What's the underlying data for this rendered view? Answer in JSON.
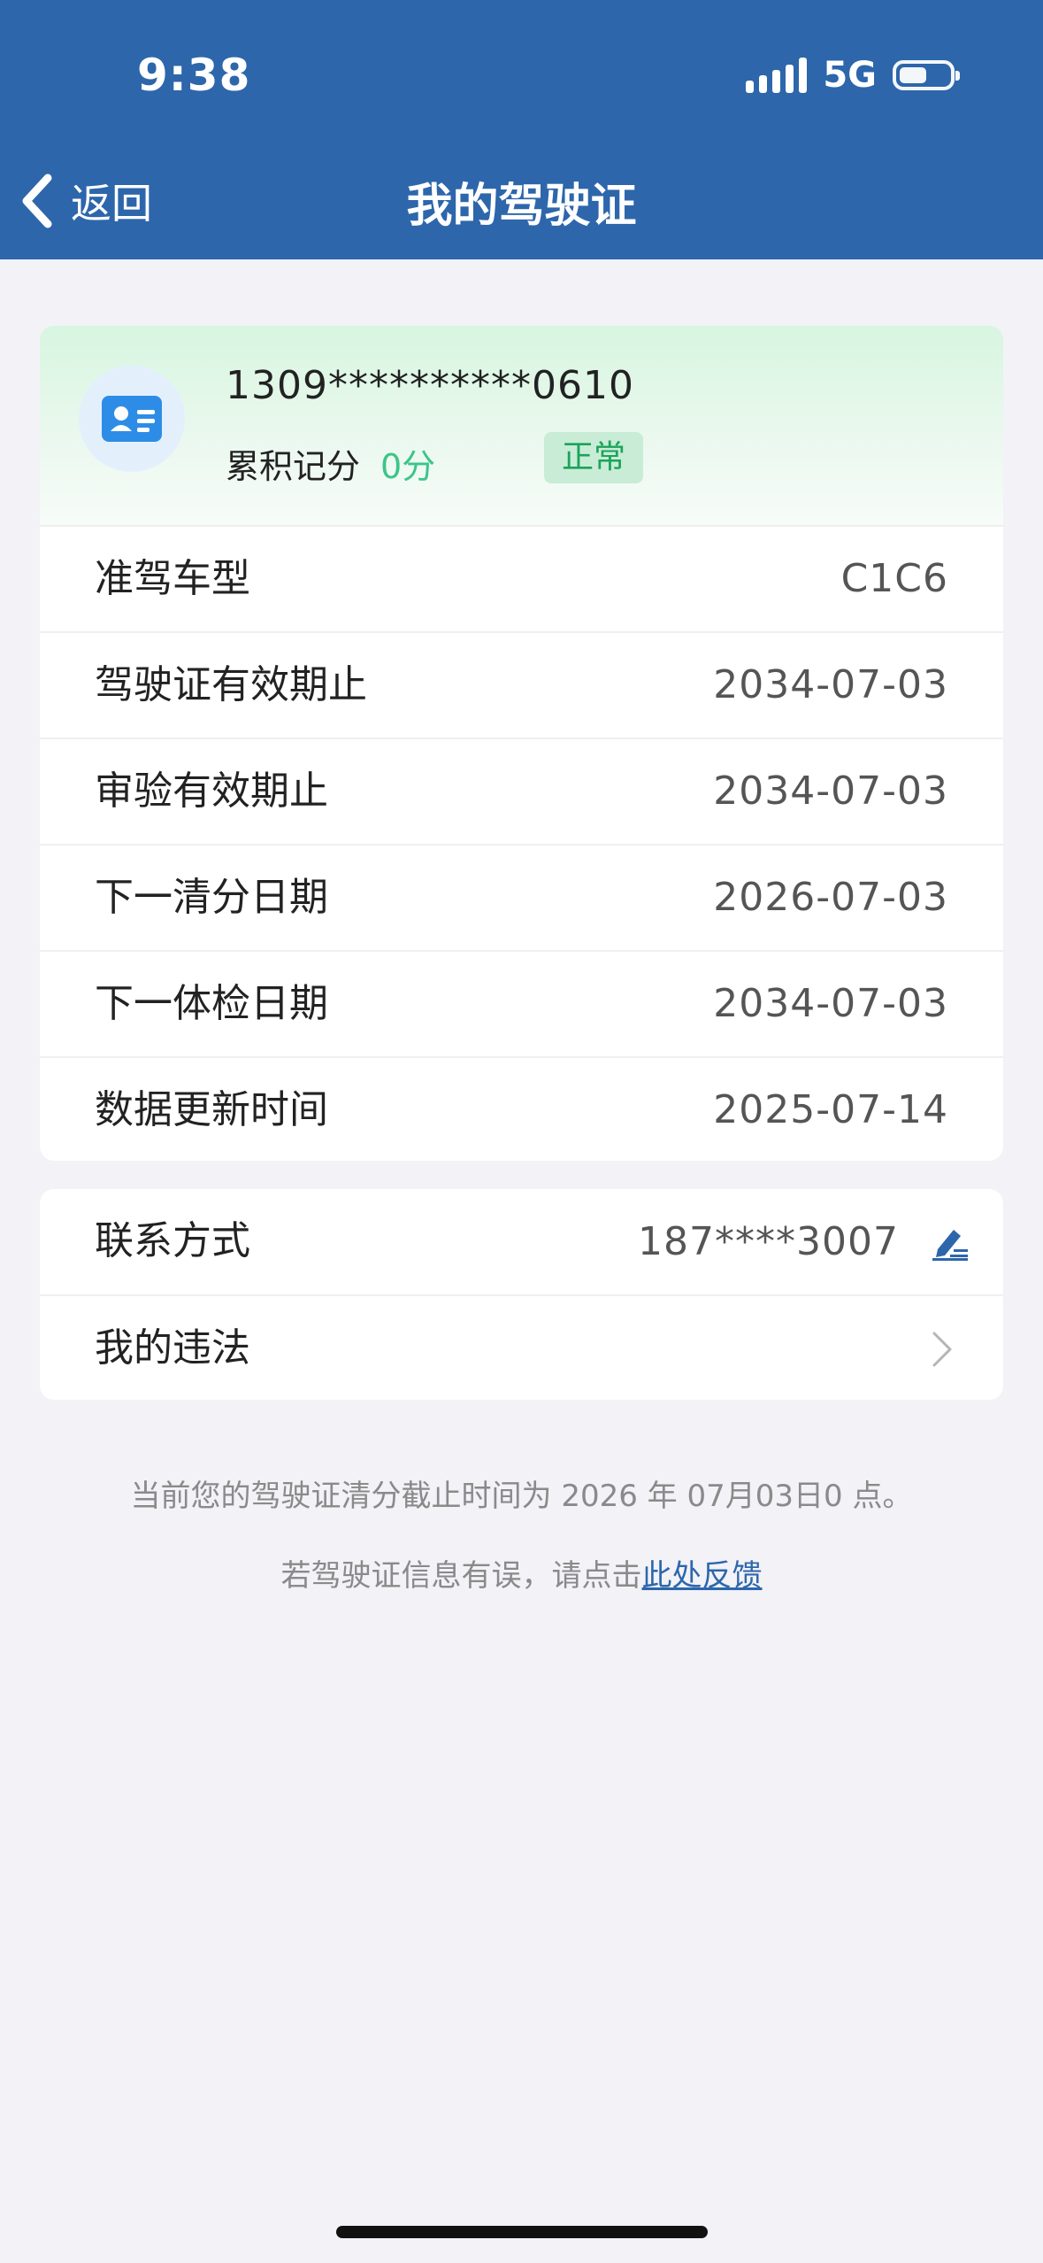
{
  "status_bar": {
    "time": "9:38",
    "network": "5G",
    "icons": [
      "signal-icon",
      "battery-icon"
    ]
  },
  "header": {
    "back_label": "返回",
    "title": "我的驾驶证",
    "icons": [
      "chevron-left-icon"
    ]
  },
  "license": {
    "number": "1309**********0610",
    "points_label": "累积记分",
    "points_value": "0分",
    "status": "正常",
    "icon": "id-card-icon"
  },
  "details": [
    {
      "label": "准驾车型",
      "value": "C1C6"
    },
    {
      "label": "驾驶证有效期止",
      "value": "2034-07-03"
    },
    {
      "label": "审验有效期止",
      "value": "2034-07-03"
    },
    {
      "label": "下一清分日期",
      "value": "2026-07-03"
    },
    {
      "label": "下一体检日期",
      "value": "2034-07-03"
    },
    {
      "label": "数据更新时间",
      "value": "2025-07-14"
    }
  ],
  "contact": {
    "label": "联系方式",
    "value": "187****3007",
    "icon": "edit-icon"
  },
  "violations": {
    "label": "我的违法",
    "icon": "chevron-right-icon"
  },
  "notice": {
    "text": "当前您的驾驶证清分截止时间为 2026 年 07月03日0 点。",
    "feedback_prefix": "若驾驶证信息有误，请点击",
    "feedback_link": "此处反馈"
  },
  "colors": {
    "header_bg": "#2d66ab",
    "accent_green": "#3cc589",
    "badge_bg": "#c9ecd6",
    "link": "#2d66ab"
  }
}
